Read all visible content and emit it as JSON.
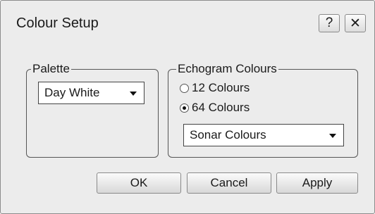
{
  "window": {
    "title": "Colour Setup",
    "help_label": "?",
    "close_label": "✕"
  },
  "palette": {
    "group_label": "Palette",
    "selected": "Day White"
  },
  "echogram": {
    "group_label": "Echogram Colours",
    "options": [
      {
        "label": "12 Colours",
        "checked": false
      },
      {
        "label": "64 Colours",
        "checked": true
      }
    ],
    "colour_scheme": "Sonar Colours"
  },
  "buttons": {
    "ok": "OK",
    "cancel": "Cancel",
    "apply": "Apply"
  }
}
